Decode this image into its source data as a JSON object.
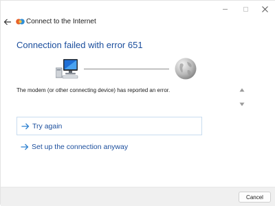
{
  "window": {
    "title": "Connect to the Internet"
  },
  "main": {
    "heading": "Connection failed with error 651",
    "error_message": "The modem (or other connecting device) has reported an error.",
    "icons": {
      "computer": "computer-icon",
      "internet": "globe-icon"
    }
  },
  "actions": [
    {
      "label": "Try again"
    },
    {
      "label": "Set up the connection anyway"
    }
  ],
  "footer": {
    "cancel_label": "Cancel"
  },
  "colors": {
    "heading": "#1a4d9c",
    "link": "#1a4d9c",
    "arrow": "#2b7fd0",
    "focus_border": "#c8dcef",
    "footer_bg": "#f0f0f0"
  }
}
